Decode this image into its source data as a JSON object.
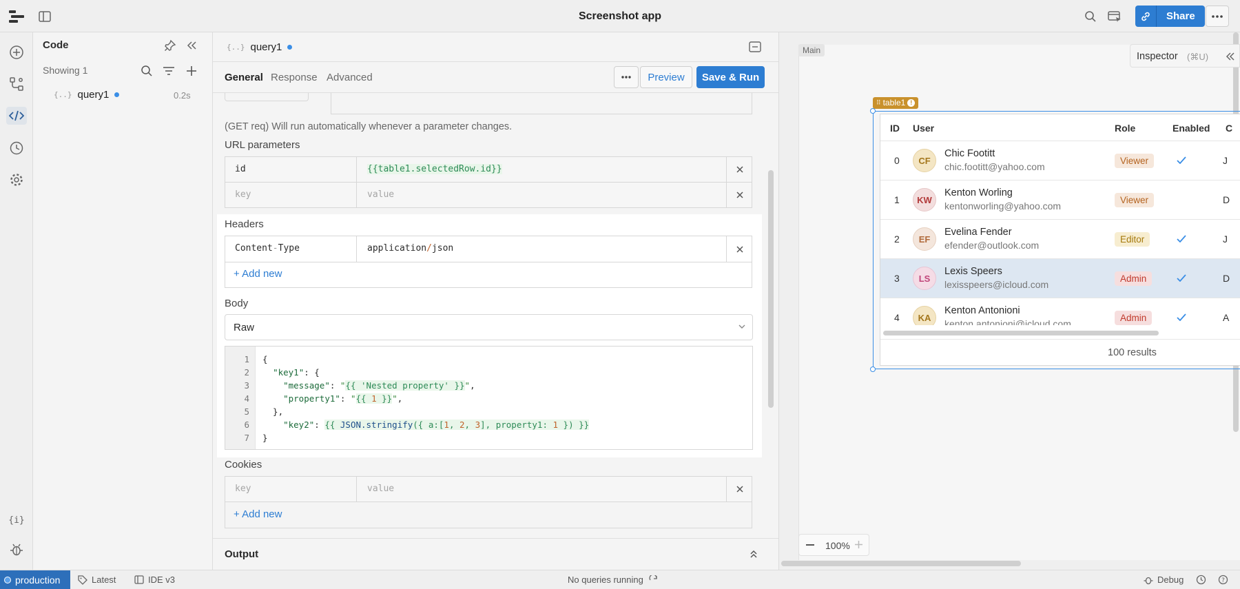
{
  "app": {
    "title": "Screenshot app",
    "share_label": "Share"
  },
  "code_panel": {
    "title": "Code",
    "showing": "Showing 1",
    "query": {
      "name": "query1",
      "time": "0.2s"
    }
  },
  "editor": {
    "tab_name": "query1",
    "subtabs": [
      "General",
      "Response",
      "Advanced"
    ],
    "preview_label": "Preview",
    "save_run_label": "Save & Run",
    "run_note": "(GET req) Will run automatically whenever a parameter changes.",
    "url_params": {
      "label": "URL parameters",
      "rows": [
        {
          "key": "id",
          "value": "{{table1.selectedRow.id}}"
        }
      ],
      "key_placeholder": "key",
      "value_placeholder": "value"
    },
    "headers": {
      "label": "Headers",
      "rows": [
        {
          "key": "Content-Type",
          "value": "application/json"
        }
      ],
      "add_new": "+ Add new"
    },
    "body": {
      "label": "Body",
      "type": "Raw",
      "line_numbers": [
        "1",
        "2",
        "3",
        "4",
        "5",
        "6",
        "7"
      ]
    },
    "cookies": {
      "label": "Cookies",
      "key_placeholder": "key",
      "value_placeholder": "value",
      "add_new": "+ Add new"
    },
    "output_label": "Output"
  },
  "canvas": {
    "main_tag": "Main",
    "inspector": "Inspector",
    "inspector_shortcut": "(⌘U)",
    "table_tag": "table1",
    "zoom": "100%",
    "table": {
      "columns": [
        "ID",
        "User",
        "Role",
        "Enabled",
        "C"
      ],
      "rows": [
        {
          "id": "0",
          "initials": "CF",
          "name": "Chic Footitt",
          "email": "chic.footitt@yahoo.com",
          "role": "Viewer",
          "enabled": true,
          "last": "J"
        },
        {
          "id": "1",
          "initials": "KW",
          "name": "Kenton Worling",
          "email": "kentonworling@yahoo.com",
          "role": "Viewer",
          "enabled": false,
          "last": "D"
        },
        {
          "id": "2",
          "initials": "EF",
          "name": "Evelina Fender",
          "email": "efender@outlook.com",
          "role": "Editor",
          "enabled": true,
          "last": "J"
        },
        {
          "id": "3",
          "initials": "LS",
          "name": "Lexis Speers",
          "email": "lexisspeers@icloud.com",
          "role": "Admin",
          "enabled": true,
          "last": "D"
        },
        {
          "id": "4",
          "initials": "KA",
          "name": "Kenton Antonioni",
          "email": "kenton.antonioni@icloud.com",
          "role": "Admin",
          "enabled": true,
          "last": "A"
        }
      ],
      "footer": "100 results"
    }
  },
  "status": {
    "env": "production",
    "version": "Latest",
    "ide": "IDE v3",
    "queries": "No queries running",
    "debug": "Debug"
  },
  "colors": {
    "accent": "#2d7dd2",
    "viewer_bg": "#f6e7db",
    "viewer_fg": "#b4631f",
    "editor_bg": "#f7edd0",
    "editor_fg": "#a67a0d",
    "admin_bg": "#f6dede",
    "admin_fg": "#c0392b"
  }
}
